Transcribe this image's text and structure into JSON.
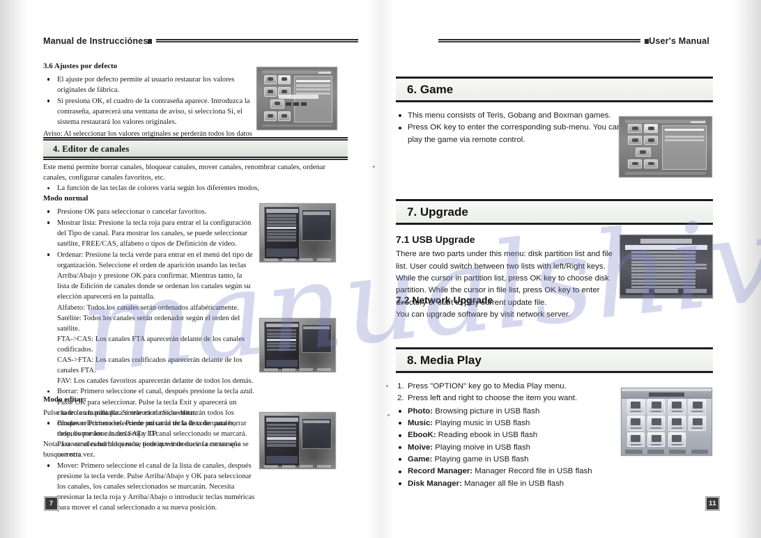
{
  "left_page": {
    "running_head": "Manual de Instrucciónes",
    "page_number": "7",
    "section_3_6": {
      "heading": "3.6 Ajustes por defecto",
      "bullets": [
        "El ajuste por defecto permite al usuario restaurar los valores originales de fábrica.",
        "Si presiona OK, el cuadro de la contraseña aparece. Introduzca la contraseña, aparecerá una ventana de aviso, si selecciona Si, el sistema restaurará los valores originales."
      ],
      "notice": "Aviso: Al seleccionar los valores originales se perderán todos los datos e información anteriormente instalados."
    },
    "section_4": {
      "band_title": "4. Editor de canales",
      "intro": "Este menú permite borrar canales, bloquear canales, mover canales, renombrar canales, ordenar canales, configurar canales favoritos, etc.",
      "intro_bullet": "La función de las teclas de colores varía según los diferentes modos,",
      "modo_normal": {
        "heading": "Modo normal",
        "b1": "Presione OK para seleccionar o cancelar favoritos.",
        "b2": "Mostrar lista: Presione la tecla roja para entrar el la configuración del Tipo de canal. Para mostrar los canales, se puede seleccionar satélite, FREE/CAS, alfabeto o tipos de Definición de vídeo.",
        "b3": "Ordenar: Presione la tecla verde para entrar en el menú del tipo de organización. Seleccione el orden de aparición usando las teclas Arriba/Abajo y presione OK para confirmar. Mientras tanto, la lista de Edición de canales donde se ordenan los canales según su elección aparecerá en la pantalla.",
        "sort_options": [
          "Alfabeto: Todos los canales serán ordenados alfabéticamente.",
          "Satélite: Todos los canales serán ordenador según el orden del satélite.",
          "FTA->CAS: Los canales FTA aparecerán delante de los canales codificados.",
          "CAS->FTA: Los canales codificados aparecerán delante de los canales FTA.",
          "FAV: Los canales favoritos aparecerán delante de todos los demás."
        ],
        "b4": "Borrar: Primero seleccione el canal, después presione la tecla azul.",
        "b4_cont": "Pulse OK para seleccionar. Pulse la tecla Exit y aparecerá un cuadro en la pantalla. Si selecciona Sí, se borrarán todos los canales seleccionados. Puede pulsar la tecla de color para borrar todo, borrar los canales SAT y TP.",
        "nota": "Nota: Los canales borrados no se podrán ver de nuevo a no ser que se busquen otra vez."
      },
      "modo_editar": {
        "heading": "Modo editar:",
        "intro": "Pulse la tecla amarilla para entrar en el modo editar.",
        "b1": "Bloquear: Primero seleccione un canal de la lista de canales, después presione la tecla roja. El canal seleccionado se marcará. Para ver el canal bloqueado, tiene que introducir la contraseña correcta.",
        "b2": "Mover: Primero seleccione el canal de la lista de canales, después presione la tecla verde. Pulse Arriba/Abajo y OK para seleccionar los canales, los canales seleccionados se marcarán. Necesita presionar la tecla roja y Arriba/Abajo o introducir          teclas numéricas para mover el canal seleccionado a su nueva posición."
      }
    },
    "figures": [
      {
        "name": "default-settings-osd",
        "caption": ""
      },
      {
        "name": "channel-editor-normal-osd",
        "caption": ""
      },
      {
        "name": "channel-delete-osd",
        "caption": ""
      },
      {
        "name": "channel-edit-mode-osd",
        "caption": ""
      }
    ]
  },
  "right_page": {
    "running_head": "User's Manual",
    "page_number": "11",
    "section_6": {
      "band_title": "6. Game",
      "bullets": [
        "This menu consists of Teris, Gobang and Boxman games.",
        "Press OK key to enter the corresponding sub-menu. You can play the game via remote control."
      ]
    },
    "section_7": {
      "band_title": "7. Upgrade",
      "sub_7_1": {
        "heading": "7.1 USB Upgrade",
        "body": "There are two parts under this menu: disk partition list and file list. User could switch between two lists with left/Right keys. While the cursor in partition list, press OK key to choose disk partition. While the cursor in file list, press OK key to enter directory or start to play current update file."
      },
      "sub_7_2": {
        "heading": "7.2 Network Upgrade",
        "body": "You can upgrade software by visit network server."
      }
    },
    "section_8": {
      "band_title": "8. Media Play",
      "steps": [
        {
          "n": "1.",
          "text": "Press \"OPTION\" key go to Media Play menu."
        },
        {
          "n": "2.",
          "text": "Press left and right to choose the item you want."
        }
      ],
      "items": [
        {
          "term": "Photo:",
          "desc": "Browsing picture in USB flash"
        },
        {
          "term": "Music:",
          "desc": "Playing music in USB flash"
        },
        {
          "term": "EbooK:",
          "desc": "Reading ebook in USB flash"
        },
        {
          "term": "Moive:",
          "desc": "Playing moive in USB flash"
        },
        {
          "term": "Game:",
          "desc": "Playing game in USB flash"
        },
        {
          "term": "Record Manager:",
          "desc": "Manager Record file in USB flash"
        },
        {
          "term": "Disk Manager:",
          "desc": "Manager all file in USB flash"
        }
      ]
    },
    "figures": [
      {
        "name": "game-menu-osd",
        "caption": ""
      },
      {
        "name": "usb-upgrade-osd",
        "caption": ""
      },
      {
        "name": "media-play-osd",
        "caption": ""
      }
    ]
  },
  "watermark": {
    "text": "manualshive.com",
    "color": "#7882c8"
  }
}
